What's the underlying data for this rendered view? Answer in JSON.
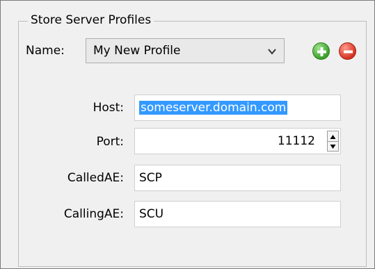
{
  "group": {
    "title": "Store Server Profiles"
  },
  "profile": {
    "name_label": "Name:",
    "selected": "My New Profile",
    "icons": {
      "dropdown": "chevron-down-icon",
      "add": "add-icon",
      "remove": "remove-icon"
    }
  },
  "host": {
    "label": "Host:",
    "value": "someserver.domain.com"
  },
  "port": {
    "label": "Port:",
    "value": "11112"
  },
  "called_ae": {
    "label": "CalledAE:",
    "value": "SCP"
  },
  "calling_ae": {
    "label": "CallingAE:",
    "value": "SCU"
  }
}
